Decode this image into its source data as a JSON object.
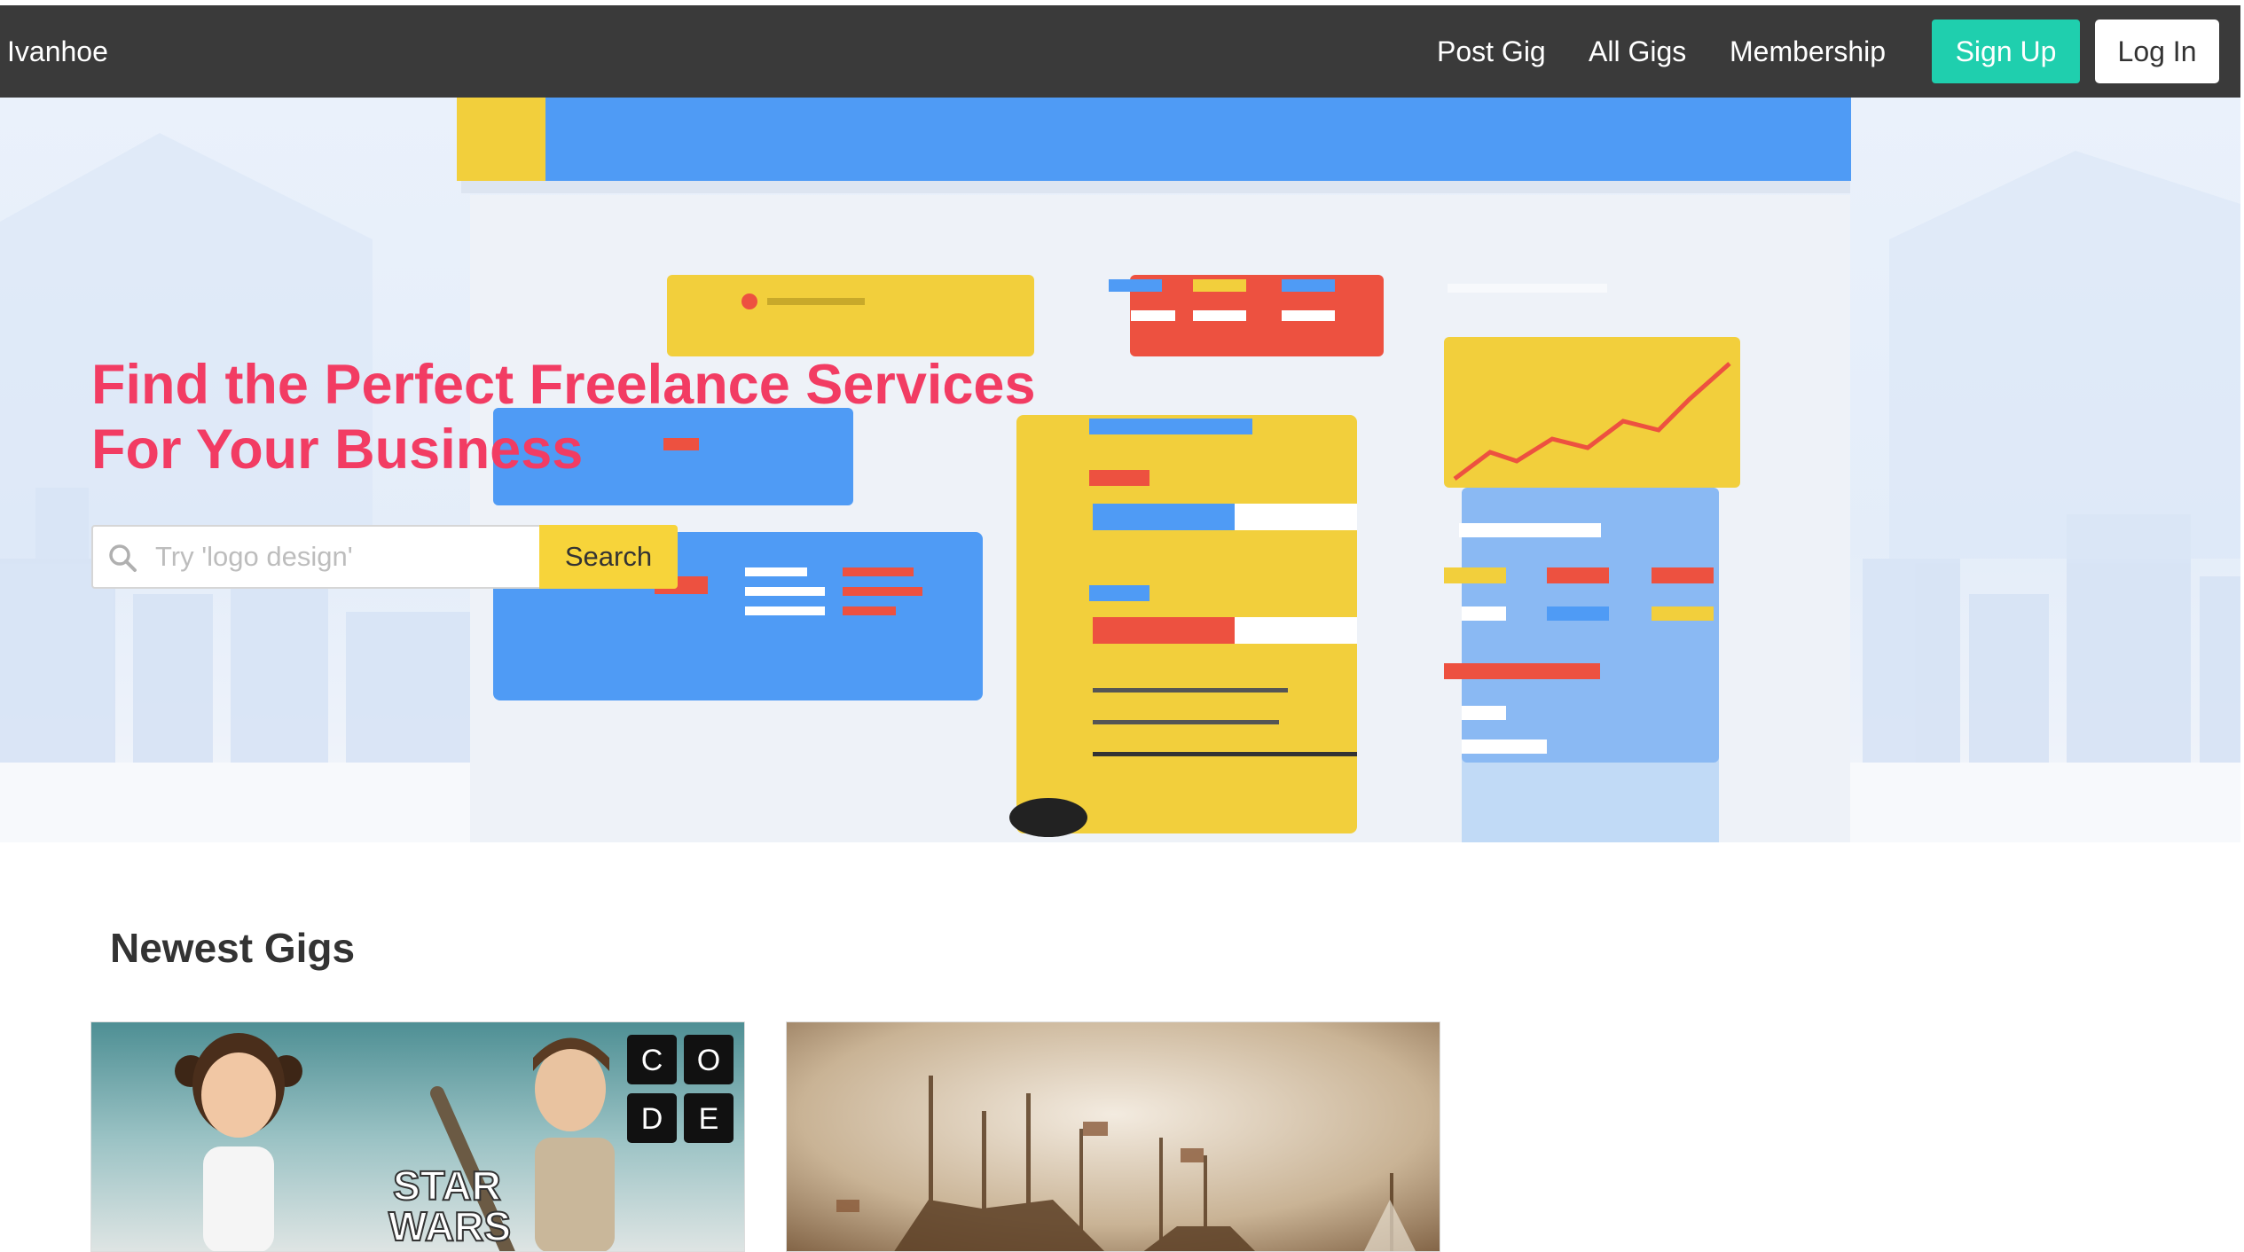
{
  "navbar": {
    "brand": "Ivanhoe",
    "links": [
      "Post Gig",
      "All Gigs",
      "Membership"
    ],
    "signup_label": "Sign Up",
    "login_label": "Log In",
    "background": "#3a3a3a",
    "signup_color": "#1fcfae"
  },
  "hero": {
    "title_line1": "Find the Perfect Freelance Services",
    "title_line2": "For Your Business",
    "title_color": "#f23c63",
    "search_placeholder": "Try 'logo design'",
    "search_button": "Search",
    "search_button_color": "#f7d43a"
  },
  "newest": {
    "title": "Newest Gigs",
    "gigs": [
      {
        "image": "star-wars-code-thumbnail",
        "overlay_logo_letters": [
          "C",
          "O",
          "D",
          "E"
        ],
        "overlay_title": "STAR WARS"
      },
      {
        "image": "sailing-ships-painting-thumbnail"
      }
    ]
  }
}
